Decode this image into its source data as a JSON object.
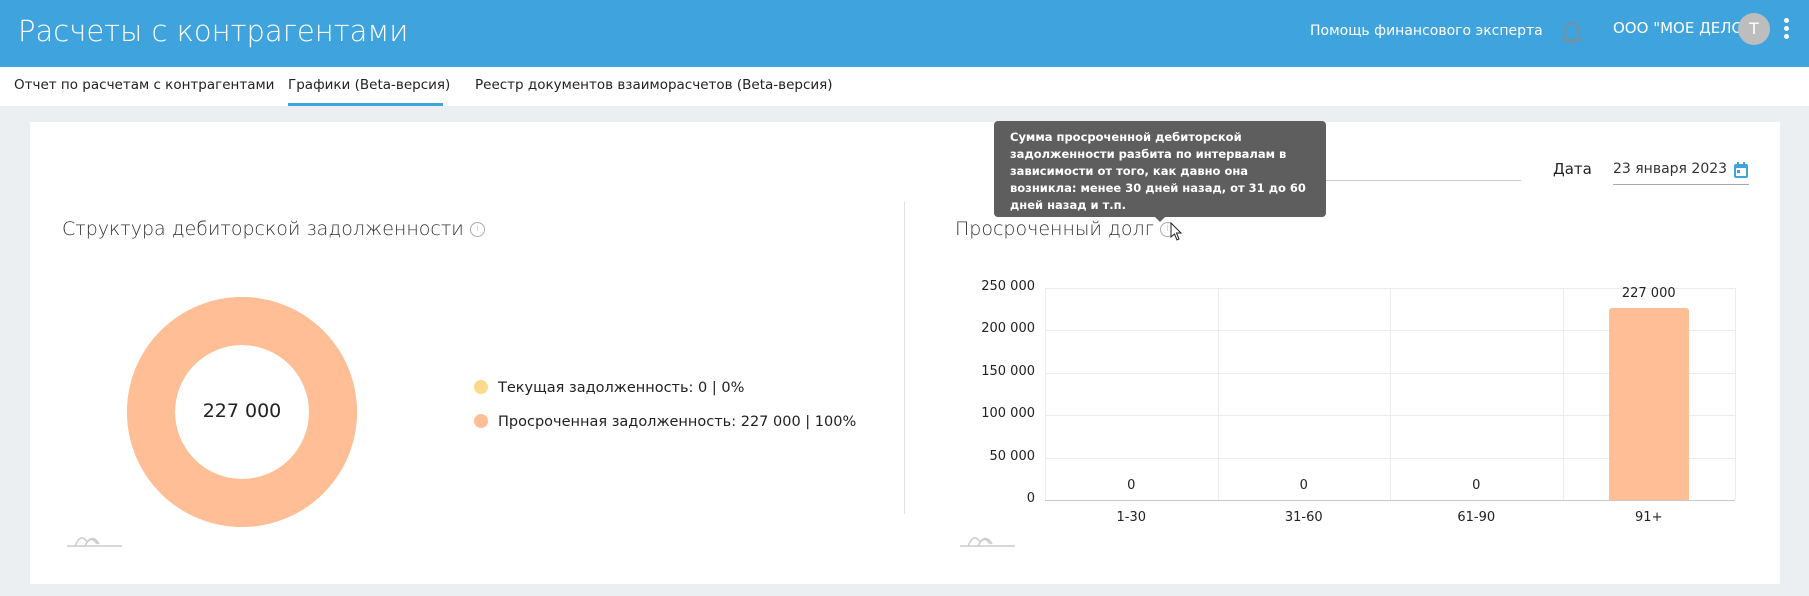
{
  "header": {
    "title": "Расчеты с контрагентами",
    "help_link": "Помощь финансового эксперта",
    "org_name": "ООО \"МОЕ ДЕЛО\"",
    "avatar_letter": "Т",
    "accent": "#3fa3de"
  },
  "tabs": [
    {
      "label": "Отчет по расчетам с контрагентами",
      "active": false
    },
    {
      "label": "Графики (Beta-версия)",
      "active": true
    },
    {
      "label": "Реестр документов взаиморасчетов (Beta-версия)",
      "active": false
    }
  ],
  "filters": {
    "date_label": "Дата",
    "date_value": "23 января 2023"
  },
  "tooltip": {
    "text": "Сумма просроченной дебиторской задолженности разбита по интервалам в зависимости от того, как давно она возникла: менее 30 дней назад, от 31 до 60 дней назад и т.п."
  },
  "chart_data": [
    {
      "type": "pie",
      "title": "Структура дебиторской задолженности",
      "center_label": "227 000",
      "slices": [
        {
          "name": "Текущая задолженность",
          "value": 0,
          "percent": 0,
          "color": "#fdd98b",
          "legend": "Текущая задолженность: 0 | 0%"
        },
        {
          "name": "Просроченная задолженность",
          "value": 227000,
          "percent": 100,
          "color": "#ffbe96",
          "legend": "Просроченная задолженность: 227 000 | 100%"
        }
      ]
    },
    {
      "type": "bar",
      "title": "Просроченный долг",
      "categories": [
        "1-30",
        "31-60",
        "61-90",
        "91+"
      ],
      "values": [
        0,
        0,
        0,
        227000
      ],
      "data_labels": [
        "0",
        "0",
        "0",
        "227 000"
      ],
      "ylim": [
        0,
        250000
      ],
      "yticks": [
        "0",
        "50 000",
        "100 000",
        "150 000",
        "200 000",
        "250 000"
      ],
      "grid": true,
      "color": "#ffbe96"
    }
  ]
}
